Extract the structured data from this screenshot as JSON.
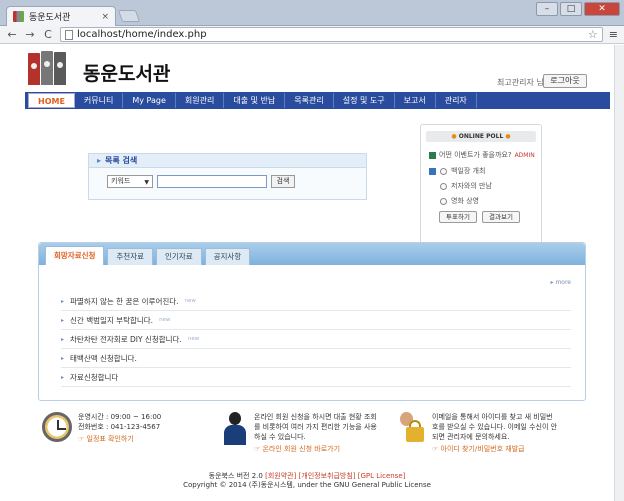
{
  "browser": {
    "tab_title": "동운도서관",
    "tab_close": "×",
    "address": "localhost/home/index.php",
    "back": "←",
    "forward": "→",
    "reload": "C"
  },
  "header": {
    "site_title": "동운도서관",
    "admin_label": "최고관리자 님",
    "logout_label": "로그아웃"
  },
  "nav": {
    "items": [
      "HOME",
      "커뮤니티",
      "My Page",
      "회원관리",
      "대출 및 반납",
      "목록관리",
      "설정 및 도구",
      "보고서",
      "관리자"
    ]
  },
  "search": {
    "title": "목록 검색",
    "select_value": "키워드",
    "button_label": "검색"
  },
  "poll": {
    "title": "ONLINE POLL",
    "question": "어떤 이벤트가 좋을까요?",
    "admin_tag": "ADMIN",
    "options": [
      "백일장 개최",
      "저자와의 만남",
      "영화 상영"
    ],
    "vote_label": "투표하기",
    "results_label": "결과보기"
  },
  "board": {
    "tabs": [
      "희망자료신청",
      "추천자료",
      "인기자료",
      "공지사항"
    ],
    "more": "more",
    "posts": [
      {
        "title": "파멸하지 않는 한 꿈은 이루어진다.",
        "tag": "new"
      },
      {
        "title": "신간 백범일지 부탁합니다.",
        "tag": "new"
      },
      {
        "title": "차탄차탄 전자회로 DIY 신청합니다.",
        "tag": "new"
      },
      {
        "title": "태백산맥 신청합니다.",
        "tag": ""
      },
      {
        "title": "자료신청합니다",
        "tag": ""
      }
    ]
  },
  "info": {
    "hours": {
      "line1": "운영시간 : 09:00 ~ 16:00",
      "line2": "전화번호 : 041-123-4567",
      "link": "☞ 일정표 확인하기"
    },
    "signup": {
      "line1": "온라인 회원 신청을 하시면 대출 현황 조회",
      "line2": "를 비롯하여 여러 가지 편리한 기능을 사용",
      "line3": "하실 수 있습니다.",
      "link": "☞ 온라인 회원 신청 바로가기"
    },
    "account": {
      "line1": "이메일을 통해서 아이디를 찾고 새 비밀번",
      "line2": "호를 받으실 수 있습니다. 이메일 수신이 안",
      "line3": "되면 관리자에 문의하세요.",
      "link": "☞ 아이디 찾기/비밀번호 재발급"
    }
  },
  "footer": {
    "name": "동운북스 버전 2.0",
    "links": "[회원약관] [개인정보취급방침] [GPL License]",
    "copyright": "Copyright © 2014 (주)동운시스템, under the GNU General Public License"
  }
}
